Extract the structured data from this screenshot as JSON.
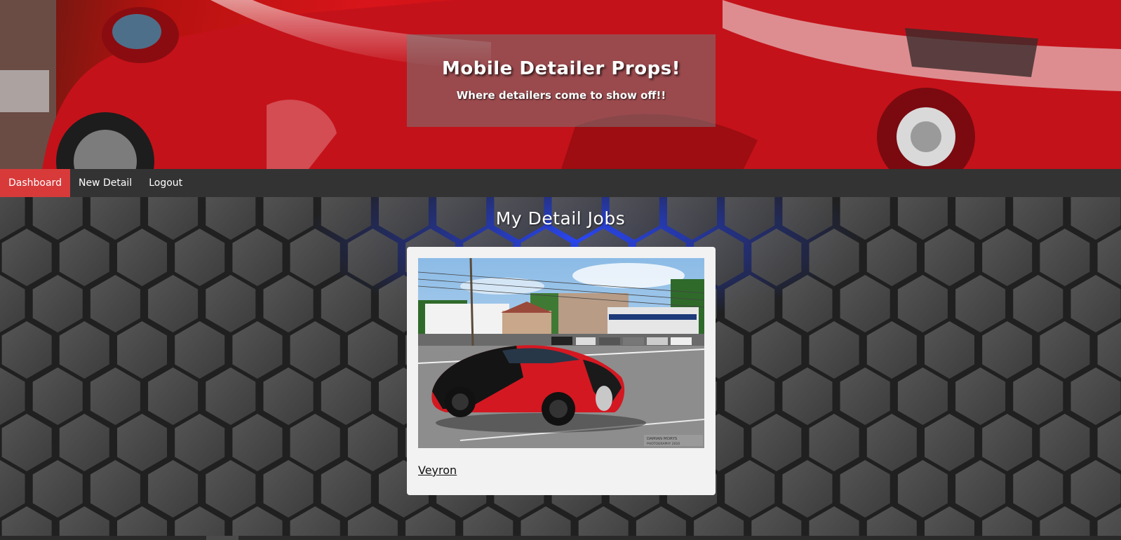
{
  "hero": {
    "title": "Mobile Detailer Props!",
    "subtitle": "Where detailers come to show off!!",
    "image_subject": "red sports car close-up"
  },
  "nav": {
    "items": [
      {
        "label": "Dashboard",
        "active": true
      },
      {
        "label": "New Detail",
        "active": false
      },
      {
        "label": "Logout",
        "active": false
      }
    ],
    "active_color": "#d83a3a",
    "bar_color": "#333333"
  },
  "main": {
    "heading": "My Detail Jobs",
    "background": "hexagon pattern"
  },
  "cards": [
    {
      "title": "Veyron",
      "image_subject": "red and black Bugatti Veyron",
      "watermark": "DAMIAN MORYS PHOTOGRAPHY 2010"
    }
  ]
}
